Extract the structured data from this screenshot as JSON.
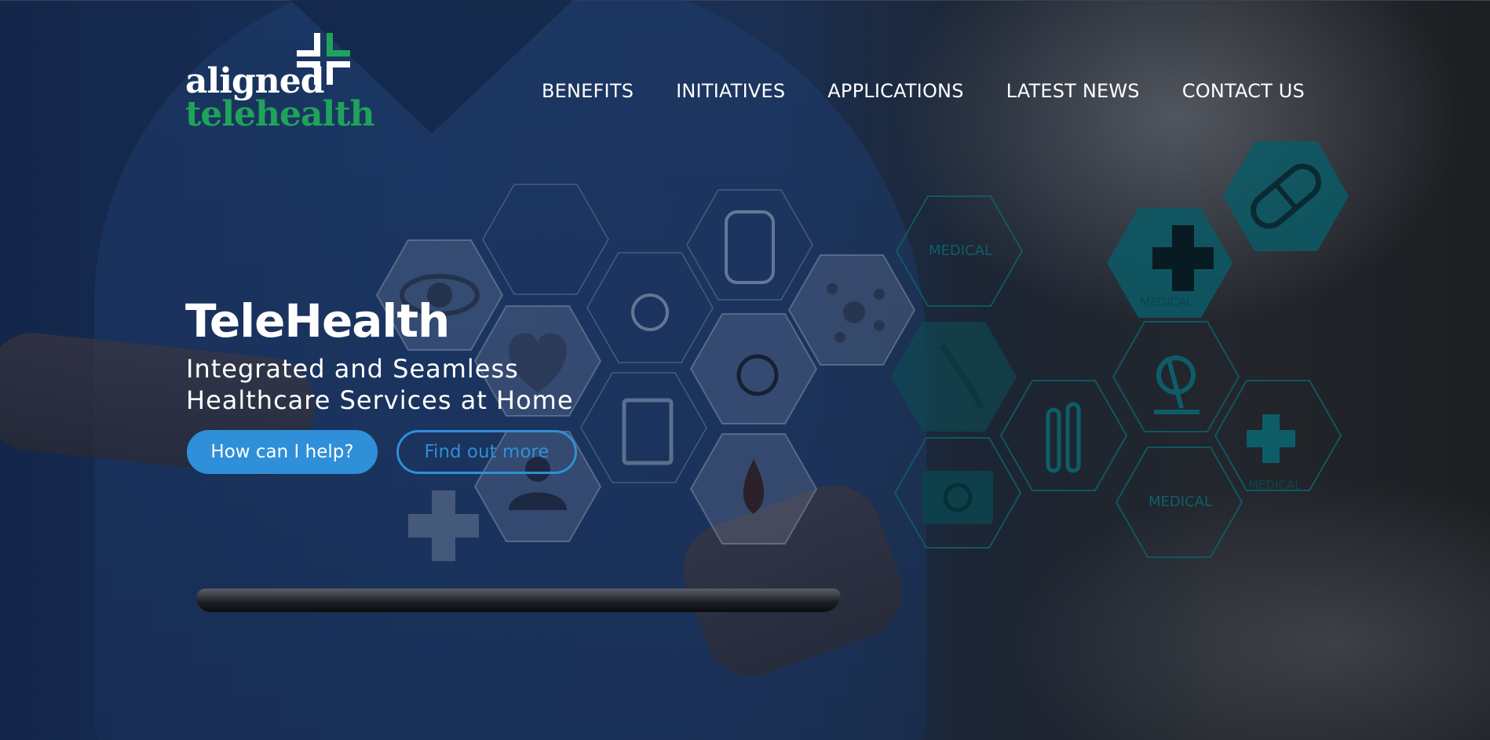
{
  "logo": {
    "line1": "aligned",
    "line2": "telehealth"
  },
  "nav": {
    "items": [
      {
        "label": "BENEFITS"
      },
      {
        "label": "INITIATIVES"
      },
      {
        "label": "APPLICATIONS"
      },
      {
        "label": "LATEST NEWS"
      },
      {
        "label": "CONTACT US"
      }
    ]
  },
  "hero": {
    "title": "TeleHealth",
    "subtitle_line1": "Integrated and Seamless",
    "subtitle_line2": "Healthcare Services at Home",
    "primary_button": "How can I help?",
    "secondary_button": "Find out more"
  },
  "background_labels": {
    "medical_1": "MEDICAL",
    "medical_2": "MEDICAL",
    "medical_3": "MEDICAL",
    "medical_4": "MEDICAL"
  },
  "colors": {
    "brand_green": "#1fa35a",
    "accent_blue": "#2f8fd8",
    "teal_hex": "#0f5f69"
  }
}
